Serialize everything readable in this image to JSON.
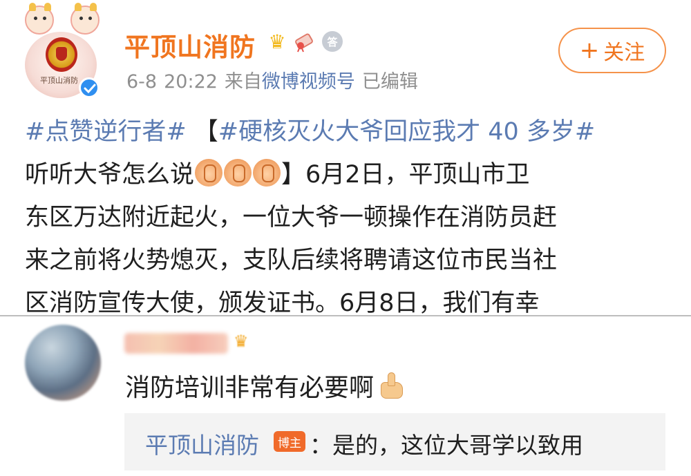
{
  "post": {
    "author": "平顶山消防",
    "avatar_caption": "平顶山消防",
    "badges": [
      "crown-badge",
      "diploma-badge",
      "medal-badge"
    ],
    "medal_text": "答",
    "meta": {
      "date": "6-8",
      "time": "20:22",
      "source_prefix": "来自",
      "source": "微博视频号",
      "edited": "已编辑"
    },
    "follow": {
      "plus": "+",
      "label": "关注"
    },
    "lines": [
      {
        "tag1": "#点赞逆行者#",
        "bracket": " 【",
        "tag2": "#硬核灭火大爷回应我才 40 多岁#"
      },
      {
        "before": "听听大爷怎么说",
        "after": "】6月2日，平顶山市卫"
      },
      {
        "text": "东区万达附近起火，一位大爷一顿操作在消防员赶"
      },
      {
        "text": "来之前将火势熄灭，支队后续将聘请这位市民当社"
      },
      {
        "text": "区消防宣传大使，颁发证书。6月8日，我们有幸"
      }
    ],
    "clap_count": 3
  },
  "comment": {
    "text": "消防培训非常有必要啊",
    "reply": {
      "name": "平顶山消防",
      "tag": "博主",
      "text": "：是的，这位大哥学以致用"
    }
  },
  "colors": {
    "name_orange": "#f0751f",
    "link_blue": "#5b7bb2",
    "meta_gray": "#8f8f8f",
    "verified_blue": "#2f8ff0",
    "reply_bg": "#f3f3f3",
    "tag_orange": "#f06a2a"
  }
}
